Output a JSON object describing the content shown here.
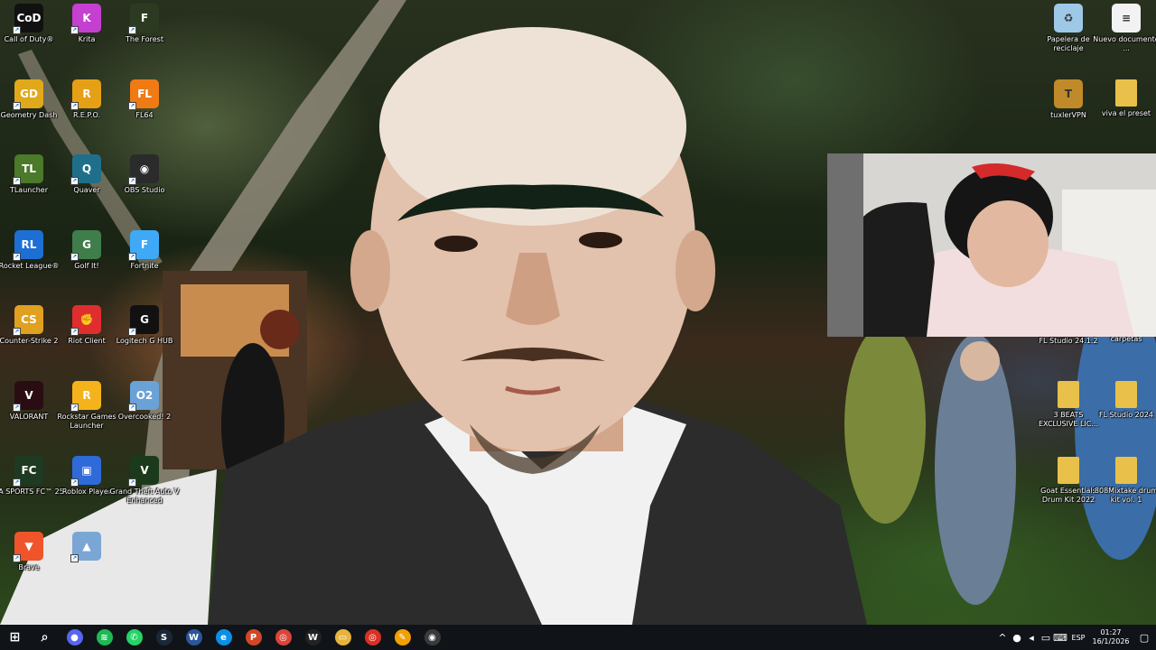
{
  "desktop": {
    "icons": [
      {
        "label": "Call of Duty®",
        "icon": "call-of-duty-icon",
        "color": "#111111",
        "glyph": "CoD"
      },
      {
        "label": "Krita",
        "icon": "krita-icon",
        "color": "#c53fd0",
        "glyph": "K"
      },
      {
        "label": "The Forest",
        "icon": "the-forest-icon",
        "color": "#2d3a22",
        "glyph": "F"
      },
      {
        "label": "Geometry Dash",
        "icon": "geometry-dash-icon",
        "color": "#e0a81a",
        "glyph": "GD"
      },
      {
        "label": "R.E.P.O.",
        "icon": "repo-icon",
        "color": "#e6a016",
        "glyph": "R"
      },
      {
        "label": "FL64",
        "icon": "fl-studio-icon",
        "color": "#f07a14",
        "glyph": "FL"
      },
      {
        "label": "TLauncher",
        "icon": "tlauncher-icon",
        "color": "#4a7a2a",
        "glyph": "TL"
      },
      {
        "label": "Quaver",
        "icon": "quaver-icon",
        "color": "#1f6f8b",
        "glyph": "Q"
      },
      {
        "label": "OBS Studio",
        "icon": "obs-studio-icon",
        "color": "#2b2b2b",
        "glyph": "◉"
      },
      {
        "label": "Rocket League®",
        "icon": "rocket-league-icon",
        "color": "#1d6fd4",
        "glyph": "RL"
      },
      {
        "label": "Golf It!",
        "icon": "golf-it-icon",
        "color": "#3f7d4b",
        "glyph": "G"
      },
      {
        "label": "Fortnite",
        "icon": "fortnite-icon",
        "color": "#3fa9f5",
        "glyph": "F"
      },
      {
        "label": "Counter-Strike 2",
        "icon": "counter-strike-icon",
        "color": "#e0a020",
        "glyph": "CS"
      },
      {
        "label": "Riot Client",
        "icon": "riot-client-icon",
        "color": "#e02e2e",
        "glyph": "✊"
      },
      {
        "label": "Logitech G HUB",
        "icon": "logitech-ghub-icon",
        "color": "#111111",
        "glyph": "G"
      },
      {
        "label": "VALORANT",
        "icon": "valorant-icon",
        "color": "#2a0d12",
        "glyph": "V"
      },
      {
        "label": "Rockstar Games Launcher",
        "icon": "rockstar-icon",
        "color": "#f4b31b",
        "glyph": "R"
      },
      {
        "label": "Overcooked! 2",
        "icon": "overcooked-icon",
        "color": "#6aa2d8",
        "glyph": "O2"
      },
      {
        "label": "EA SPORTS FC™ 25",
        "icon": "ea-fc-icon",
        "color": "#1e3a22",
        "glyph": "FC"
      },
      {
        "label": "Roblox Player",
        "icon": "roblox-icon",
        "color": "#2f6ad9",
        "glyph": "▣"
      },
      {
        "label": "Grand Theft Auto V Enhanced",
        "icon": "gta-v-icon",
        "color": "#1b3a1b",
        "glyph": "V"
      },
      {
        "label": "Brave",
        "icon": "brave-icon",
        "color": "#f0542b",
        "glyph": "▼"
      },
      {
        "label": "",
        "icon": "image-file-icon",
        "color": "#7aa6d6",
        "glyph": "▲"
      }
    ],
    "right_icons": [
      {
        "label": "Papelera de reciclaje",
        "icon": "recycle-bin-icon",
        "color": "#9ec8e8",
        "glyph": "♻"
      },
      {
        "label": "Nuevo documento ...",
        "icon": "text-document-icon",
        "color": "#f2f2f2",
        "glyph": "≡"
      },
      {
        "label": "tuxlerVPN",
        "icon": "tuxler-vpn-icon",
        "color": "#c08a2a",
        "glyph": "T"
      },
      {
        "label": "viva el preset",
        "icon": "folder-icon",
        "color": "#e8c04a",
        "glyph": ""
      },
      {
        "label": "FL Studio 24.1.2",
        "icon": "fl-studio-icon",
        "color": "#f07a14",
        "glyph": "FL"
      },
      {
        "label": "carpetas",
        "icon": "folder-icon",
        "color": "#e8c04a",
        "glyph": ""
      },
      {
        "label": "3 BEATS EXCLUSIVE LIC...",
        "icon": "folder-icon",
        "color": "#e8c04a",
        "glyph": ""
      },
      {
        "label": "FL Studio 2024",
        "icon": "folder-icon",
        "color": "#e8c04a",
        "glyph": ""
      },
      {
        "label": "Goat Essentials Drum Kit 2022",
        "icon": "folder-icon",
        "color": "#e8c04a",
        "glyph": ""
      },
      {
        "label": "808Mixtake drum kit vol. 1",
        "icon": "folder-icon",
        "color": "#e8c04a",
        "glyph": ""
      }
    ]
  },
  "taskbar": {
    "apps": [
      {
        "name": "start-button",
        "glyph": "⊞",
        "color": "transparent"
      },
      {
        "name": "search-button",
        "glyph": "⌕",
        "color": "transparent"
      },
      {
        "name": "discord-like-app",
        "glyph": "●",
        "color": "#5865f2"
      },
      {
        "name": "spotify-app",
        "glyph": "≋",
        "color": "#1db954"
      },
      {
        "name": "whatsapp-app",
        "glyph": "✆",
        "color": "#25d366"
      },
      {
        "name": "steam-app",
        "glyph": "S",
        "color": "#1b2838"
      },
      {
        "name": "word-app",
        "glyph": "W",
        "color": "#2b579a"
      },
      {
        "name": "edge-app",
        "glyph": "e",
        "color": "#0c8fe6"
      },
      {
        "name": "powerpoint-app",
        "glyph": "P",
        "color": "#d24726"
      },
      {
        "name": "chrome-app",
        "glyph": "◎",
        "color": "#db4437"
      },
      {
        "name": "w-app",
        "glyph": "W",
        "color": "#222222"
      },
      {
        "name": "file-explorer-app",
        "glyph": "▭",
        "color": "#e8b33a"
      },
      {
        "name": "chrome-dev-app",
        "glyph": "◎",
        "color": "#d93025"
      },
      {
        "name": "pen-app",
        "glyph": "✎",
        "color": "#f0a000"
      },
      {
        "name": "obs-app",
        "glyph": "◉",
        "color": "#3a3a3a"
      }
    ],
    "tray": {
      "chevron": "^",
      "language": "ESP",
      "time": "01:27",
      "date": "16/1/2026"
    }
  }
}
